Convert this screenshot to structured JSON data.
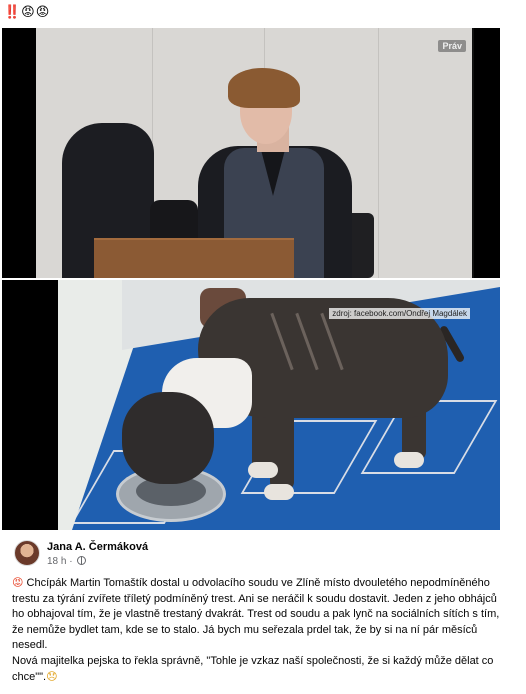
{
  "header": {
    "emojis": "‼️😡😡"
  },
  "photos": {
    "courtroom_watermark": "Práv",
    "dog_watermark": "zdroj: facebook.com/Ondřej Magdálek"
  },
  "post": {
    "author": "Jana A. Čermáková",
    "time": "18 h",
    "separator": "·",
    "text_emoji": "😡",
    "paragraph_1": "Chcípák Martin Tomaštík dostal u odvolacího soudu ve Zlíně místo dvouletého nepodmíněného trestu za týrání zvířete tříletý podmíněný trest. Ani se neráčil k soudu dostavit. Jeden z jeho obhájců ho obhajoval tím, že je vlastně trestaný dvakrát. Trest od soudu a pak lynč na sociálních sítích s tím, že nemůže bydlet tam, kde se to stalo. Já bych mu seřezala prdel tak, že by si na ní pár měsíců nesedl.",
    "paragraph_2": "Nová majitelka pejska to řekla správně, \"Tohle je vzkaz naší společnosti, že si každý může dělat co chce\"\".",
    "end_emoji": "😞"
  }
}
